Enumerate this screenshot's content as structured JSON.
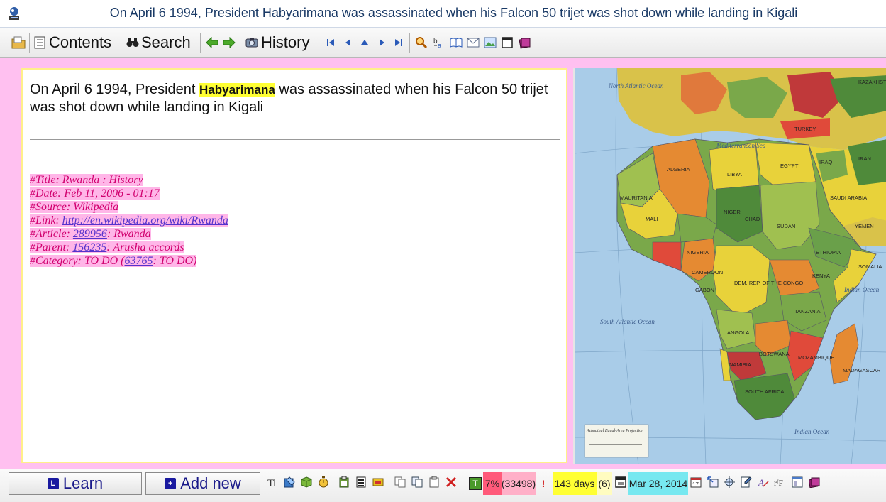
{
  "window": {
    "title": "On April 6 1994, President Habyarimana was assassinated when his Falcon 50 trijet was shot down while landing in Kigali"
  },
  "toolbar": {
    "contents_label": "Contents",
    "search_label": "Search",
    "history_label": "History"
  },
  "article": {
    "headline_before": "On April 6 1994, President ",
    "headline_highlight": "Habyarimana",
    "headline_after": " was assassinated when his Falcon 50 trijet was shot down while landing in Kigali",
    "meta": {
      "title": "#Title: Rwanda : History",
      "date": "#Date: Feb 11, 2006 - 01:17",
      "source": "#Source: Wikipedia",
      "link_prefix": "#Link: ",
      "link_url": "http://en.wikipedia.org/wiki/Rwanda",
      "article_prefix": "#Article: ",
      "article_id": "289956",
      "article_suffix": ": Rwanda",
      "parent_prefix": "#Parent: ",
      "parent_id": "156235",
      "parent_suffix": ": Arusha accords",
      "category_prefix": "#Category: TO DO (",
      "category_id": "63765",
      "category_suffix": ": TO DO)"
    }
  },
  "map": {
    "labels": {
      "north_atlantic": "North Atlantic Ocean",
      "south_atlantic": "South Atlantic Ocean",
      "indian": "Indian Ocean",
      "indian2": "Indian Ocean",
      "algeria": "ALGERIA",
      "libya": "LIBYA",
      "egypt": "EGYPT",
      "niger": "NIGER",
      "chad": "CHAD",
      "sudan": "SUDAN",
      "ethiopia": "ETHIOPIA",
      "somalia": "SOMALIA",
      "angola": "ANGOLA",
      "tanzania": "TANZANIA",
      "south_africa": "SOUTH AFRICA",
      "madagascar": "MADAGASCAR",
      "turkey": "TURKEY",
      "iraq": "IRAQ",
      "iran": "IRAN",
      "saudi": "SAUDI ARABIA",
      "mauritania": "MAURITANIA",
      "mali": "MALI",
      "kenya": "KENYA",
      "congo": "DEM. REP. OF THE CONGO",
      "botswana": "BOTSWANA",
      "namibia": "NAMIBIA",
      "nigeria": "NIGERIA",
      "cameroon": "CAMEROON",
      "gabon": "GABON",
      "mozambique": "MOZAMBIQUE",
      "yemen": "YEMEN",
      "kazakhstan": "KAZAKHSTAN",
      "mediterranean": "Mediterranean Sea",
      "legend": "Azimuthal Equal-Area Projection"
    }
  },
  "statusbar": {
    "learn_label": "Learn",
    "learn_badge": "L",
    "addnew_label": "Add new",
    "addnew_badge": "+",
    "percent": "7%",
    "count": "(33498)",
    "exclaim": "!",
    "days": "143 days",
    "days_count": "(6)",
    "date": "Mar 28, 2014",
    "t_badge": "T",
    "cal_num": "17",
    "rf_label": "rᶠF",
    "colors": {
      "percent_bg": "#ff5a7a",
      "count_bg": "#ffb0c8",
      "days_bg": "#ffff33",
      "days_count_bg": "#fffcc0",
      "date_bg": "#77e8f0"
    }
  }
}
